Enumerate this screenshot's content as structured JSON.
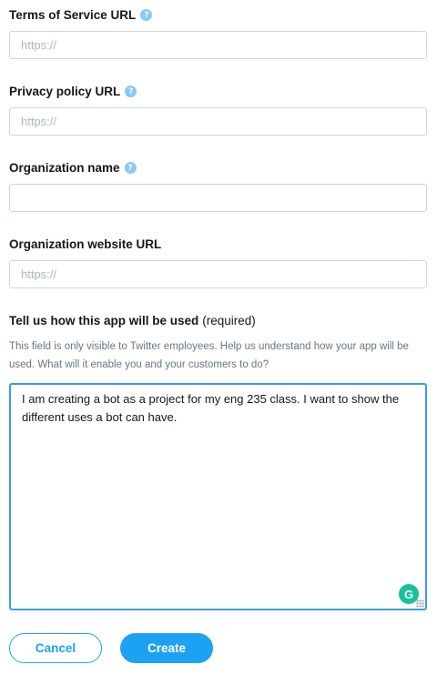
{
  "fields": {
    "terms": {
      "label": "Terms of Service URL",
      "placeholder": "https://",
      "value": ""
    },
    "privacy": {
      "label": "Privacy policy URL",
      "placeholder": "https://",
      "value": ""
    },
    "org_name": {
      "label": "Organization name",
      "placeholder": "",
      "value": ""
    },
    "org_website": {
      "label": "Organization website URL",
      "placeholder": "https://",
      "value": ""
    }
  },
  "usage": {
    "label": "Tell us how this app will be used",
    "required_note": "(required)",
    "help_text": "This field is only visible to Twitter employees. Help us understand how your app will be used. What will it enable you and your customers to do?",
    "value": "I am creating a bot as a project for my eng 235 class. I want to show the different uses a bot can have."
  },
  "buttons": {
    "cancel": "Cancel",
    "create": "Create"
  },
  "icons": {
    "help": "question-mark-icon",
    "grammarly": "grammarly-icon",
    "resize": "resize-handle-icon"
  },
  "colors": {
    "accent": "#1da1f2",
    "help_icon": "#88c9f9",
    "focus_border": "#3a9fe3",
    "grammarly": "#15c39a"
  }
}
